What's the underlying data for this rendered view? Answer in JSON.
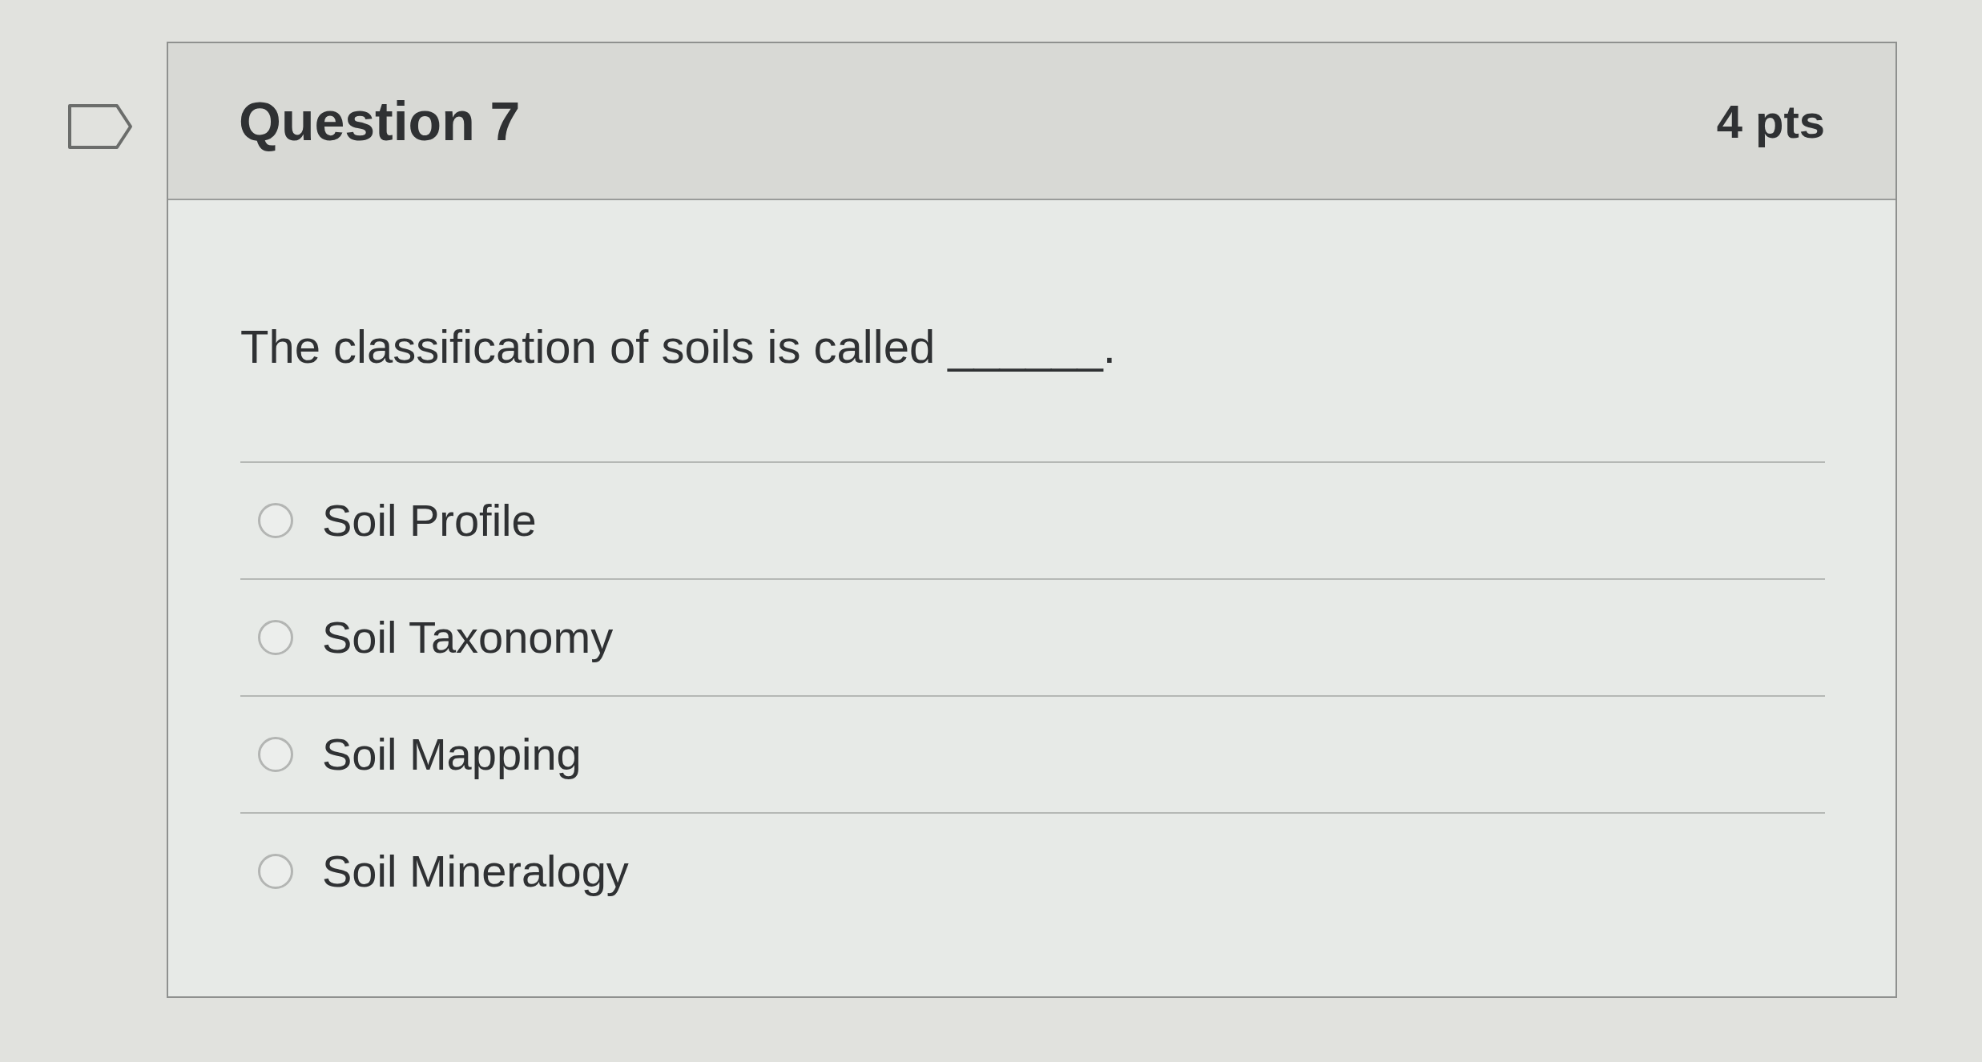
{
  "question": {
    "flagged": false,
    "title": "Question 7",
    "points": "4 pts",
    "text": "The classification of soils is called ______."
  },
  "answers": [
    {
      "label": "Soil Profile",
      "selected": false
    },
    {
      "label": "Soil Taxonomy",
      "selected": false
    },
    {
      "label": "Soil Mapping",
      "selected": false
    },
    {
      "label": "Soil Mineralogy",
      "selected": false
    }
  ]
}
